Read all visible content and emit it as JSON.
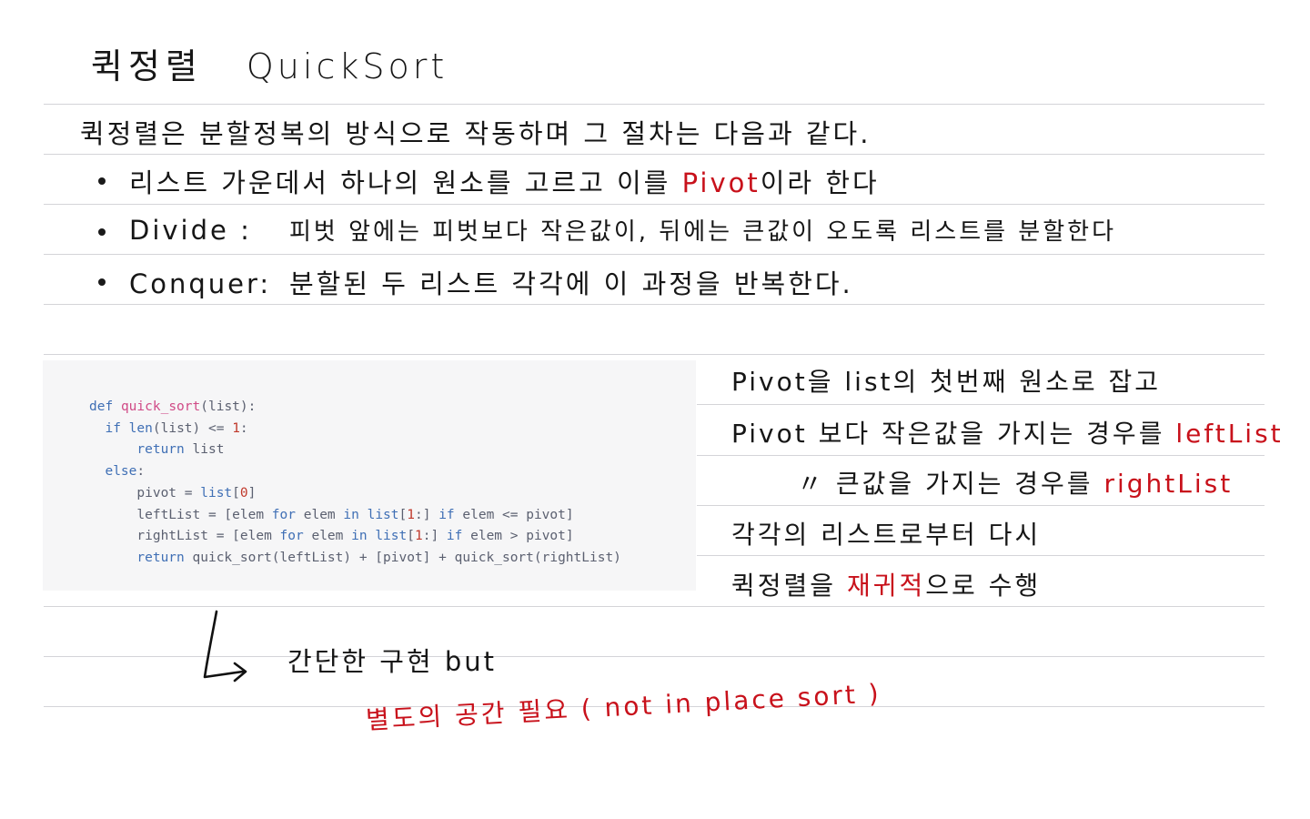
{
  "title": {
    "korean": "퀵정렬",
    "english": "QuickSort"
  },
  "intro": "퀵정렬은  분할정복의  방식으로  작동하며  그  절차는  다음과  같다.",
  "bullets": [
    {
      "before": "리스트  가운데서  하나의  원소를  고르고  이를 ",
      "highlight": "Pivot",
      "after": "이라  한다"
    },
    {
      "label": "Divide :",
      "text": "피벗  앞에는  피벗보다  작은값이,  뒤에는  큰값이  오도록  리스트를  분할한다"
    },
    {
      "label": "Conquer:",
      "text": "분할된  두  리스트  각각에   이  과정을  반복한다."
    }
  ],
  "code": {
    "line1_kw": "def",
    "line1_fn": "quick_sort",
    "line1_rest": "(list):",
    "line2_kw": "if",
    "line2_fn": "len",
    "line2_rest": "(list) <= ",
    "line2_num": "1",
    "line2_end": ":",
    "line3_kw": "return",
    "line3_rest": " list",
    "line4_kw": "else",
    "line4_end": ":",
    "line5_a": "pivot = ",
    "line5_b": "list",
    "line5_c": "[",
    "line5_num": "0",
    "line5_d": "]",
    "line6_a": "leftList = [elem ",
    "line6_for": "for",
    "line6_b": " elem ",
    "line6_in": "in",
    "line6_list": " list",
    "line6_c": "[",
    "line6_num": "1",
    "line6_d": ":] ",
    "line6_if": "if",
    "line6_e": " elem <= pivot]",
    "line7_a": "rightList = [elem ",
    "line7_for": "for",
    "line7_b": " elem ",
    "line7_in": "in",
    "line7_list": " list",
    "line7_c": "[",
    "line7_num": "1",
    "line7_d": ":] ",
    "line7_if": "if",
    "line7_e": " elem > pivot]",
    "line8_kw": "return",
    "line8_rest": " quick_sort(leftList) + [pivot] + quick_sort(rightList)"
  },
  "side_notes": [
    {
      "text": "Pivot을  list의  첫번째  원소로  잡고"
    },
    {
      "text": "Pivot 보다  작은값을  가지는  경우를 ",
      "highlight": "leftList"
    },
    {
      "text": "〃    큰값을  가지는  경우를 ",
      "highlight": "rightList"
    },
    {
      "text": "각각의  리스트로부터  다시"
    },
    {
      "before": "퀵정렬을  ",
      "highlight": "재귀적",
      "after": "으로  수행"
    }
  ],
  "arrow_note": "간단한  구현   but",
  "red_note": "별도의  공간  필요 ( not   in   place   sort )",
  "colors": {
    "ink": "#161616",
    "red_ink": "#c8111b",
    "rule": "#d4d4d8",
    "code_bg": "#f6f6f7",
    "keyword": "#3f6fb5",
    "function": "#d04a86",
    "number": "#c0392b"
  }
}
